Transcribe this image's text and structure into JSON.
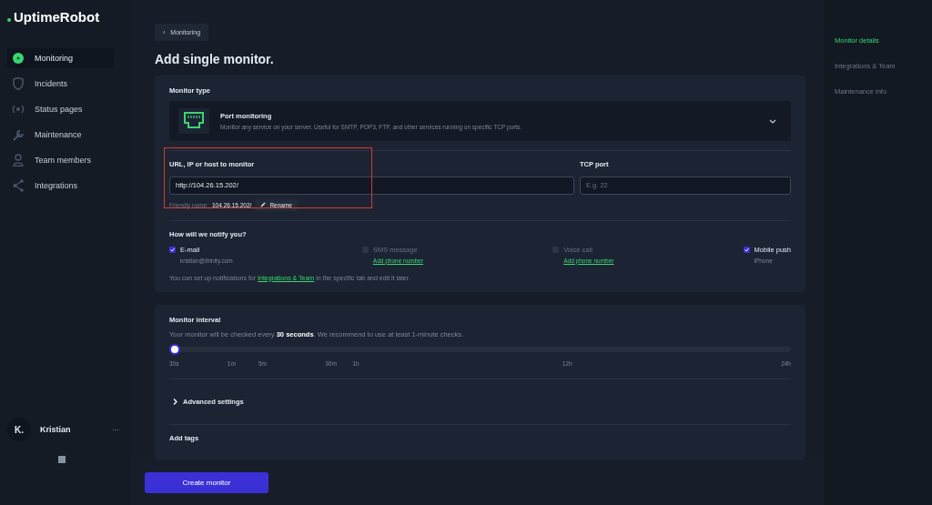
{
  "logo": {
    "text": "UptimeRobot"
  },
  "sidebar": {
    "items": [
      {
        "label": "Monitoring",
        "selected": true
      },
      {
        "label": "Incidents",
        "selected": false
      },
      {
        "label": "Status pages",
        "selected": false
      },
      {
        "label": "Maintenance",
        "selected": false
      },
      {
        "label": "Team members",
        "selected": false
      },
      {
        "label": "Integrations",
        "selected": false
      }
    ]
  },
  "user": {
    "initial": "K.",
    "name": "Kristian",
    "menu": "···"
  },
  "breadcrumb": {
    "back": "‹",
    "label": "Monitoring"
  },
  "title": "Add single monitor.",
  "monitor_type": {
    "label": "Monitor type",
    "name": "Port monitoring",
    "description": "Monitor any service on your server. Useful for SMTP, POP3, FTP, and other services running on specific TCP ports."
  },
  "url_field": {
    "label": "URL, IP or host to monitor",
    "value": "http://104.26.15.202/",
    "friendly_label": "Friendly name:",
    "friendly_value": "104.26.15.202/",
    "rename": "Rename",
    "highlighted": true
  },
  "port_field": {
    "label": "TCP port",
    "placeholder": "E.g. 22"
  },
  "notify": {
    "title": "How will we notify you?",
    "channels": [
      {
        "label": "E-mail",
        "checked": true,
        "detail": "kristian@itrinity.com",
        "kind": "text"
      },
      {
        "label": "SMS message",
        "checked": false,
        "detail": "Add phone number",
        "kind": "link"
      },
      {
        "label": "Voice call",
        "checked": false,
        "detail": "Add phone number",
        "kind": "link"
      },
      {
        "label": "Mobile push",
        "checked": true,
        "detail": "iPhone",
        "kind": "text"
      }
    ],
    "note_before": "You can set up notifications for",
    "note_link": "Integrations & Team",
    "note_after": "in the specific tab and edit it later."
  },
  "interval": {
    "title": "Monitor interval",
    "description": "Your monitor will be checked every **30 seconds**. We recommend to use at least 1-minute checks.",
    "level": 0,
    "ticks": [
      "30s",
      "1m",
      "5m",
      "30m",
      "1h",
      "12h",
      "24h"
    ]
  },
  "advanced": {
    "label": "Advanced settings",
    "expanded": false
  },
  "tags": {
    "title": "Add tags"
  },
  "create_button": "Create monitor",
  "right_nav": [
    {
      "label": "Monitor details",
      "selected": true
    },
    {
      "label": "Integrations & Team",
      "selected": false
    },
    {
      "label": "Maintenance info",
      "selected": false
    }
  ]
}
